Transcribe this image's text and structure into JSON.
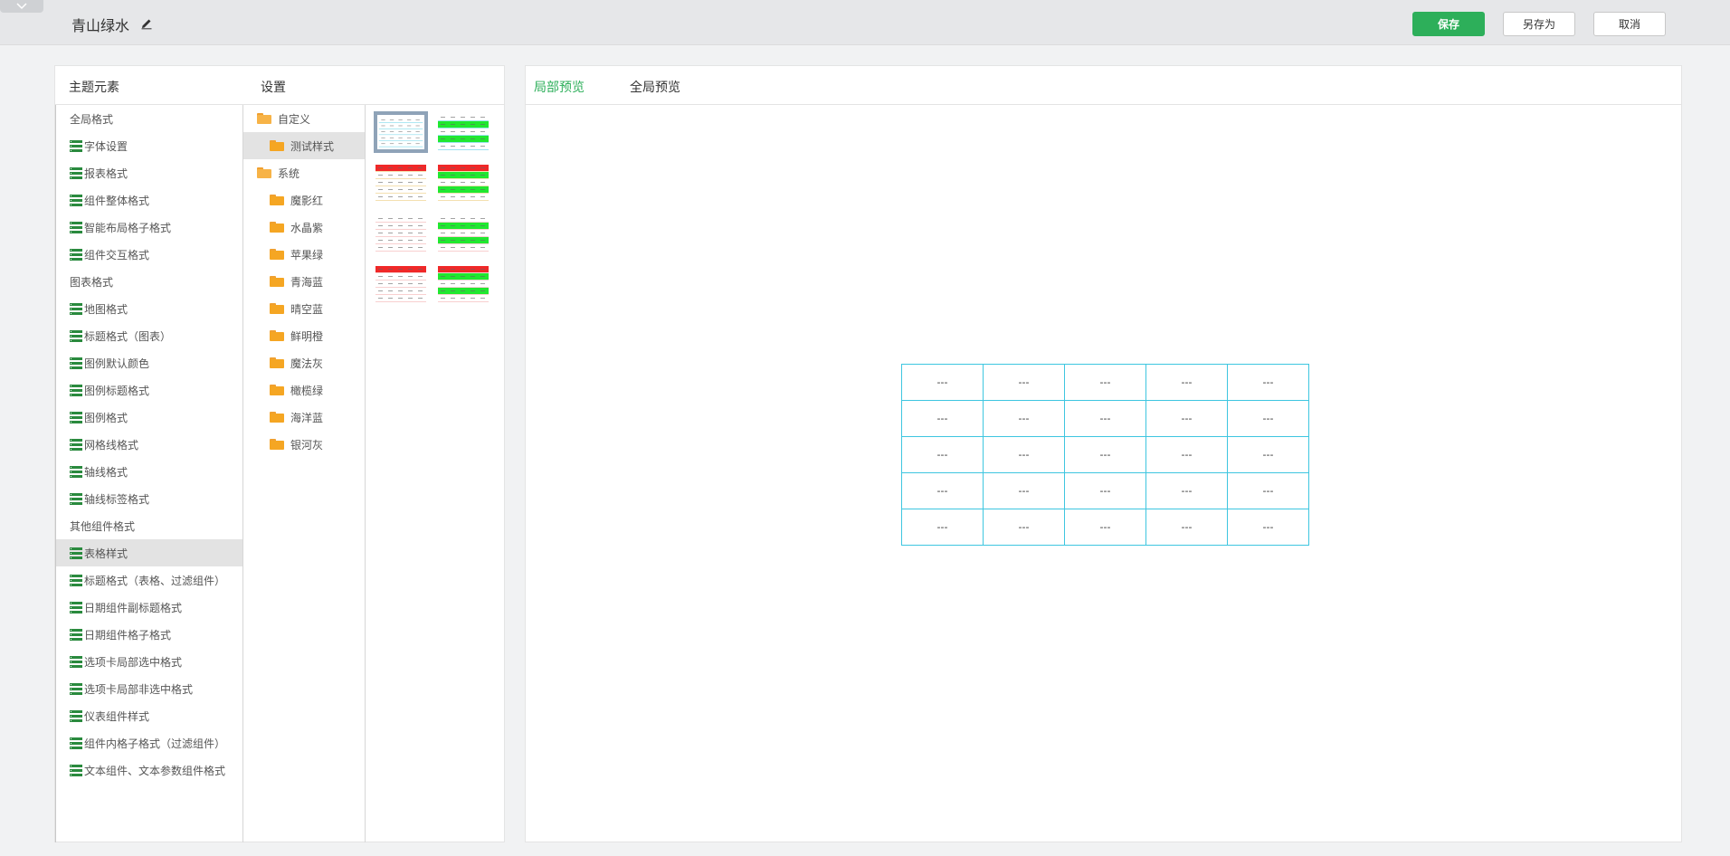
{
  "header": {
    "title": "青山绿水",
    "save_label": "保存",
    "save_as_label": "另存为",
    "cancel_label": "取消"
  },
  "left_panel": {
    "elements_heading": "主题元素",
    "settings_heading": "设置",
    "elements": [
      {
        "label": "全局格式",
        "group": true
      },
      {
        "label": "字体设置",
        "group": false
      },
      {
        "label": "报表格式",
        "group": false
      },
      {
        "label": "组件整体格式",
        "group": false
      },
      {
        "label": "智能布局格子格式",
        "group": false
      },
      {
        "label": "组件交互格式",
        "group": false
      },
      {
        "label": "图表格式",
        "group": true
      },
      {
        "label": "地图格式",
        "group": false
      },
      {
        "label": "标题格式（图表）",
        "group": false
      },
      {
        "label": "图例默认颜色",
        "group": false
      },
      {
        "label": "图例标题格式",
        "group": false
      },
      {
        "label": "图例格式",
        "group": false
      },
      {
        "label": "网格线格式",
        "group": false
      },
      {
        "label": "轴线格式",
        "group": false
      },
      {
        "label": "轴线标签格式",
        "group": false
      },
      {
        "label": "其他组件格式",
        "group": true
      },
      {
        "label": "表格样式",
        "group": false,
        "selected": true
      },
      {
        "label": "标题格式（表格、过滤组件）",
        "group": false
      },
      {
        "label": "日期组件副标题格式",
        "group": false
      },
      {
        "label": "日期组件格子格式",
        "group": false
      },
      {
        "label": "选项卡局部选中格式",
        "group": false
      },
      {
        "label": "选项卡局部非选中格式",
        "group": false
      },
      {
        "label": "仪表组件样式",
        "group": false
      },
      {
        "label": "组件内格子格式（过滤组件）",
        "group": false
      },
      {
        "label": "文本组件、文本参数组件格式",
        "group": false
      }
    ],
    "tree": [
      {
        "label": "自定义",
        "level": 0,
        "open": true
      },
      {
        "label": "测试样式",
        "level": 1,
        "selected": true
      },
      {
        "label": "系统",
        "level": 0,
        "open": true
      },
      {
        "label": "魔影红",
        "level": 1
      },
      {
        "label": "水晶紫",
        "level": 1
      },
      {
        "label": "苹果绿",
        "level": 1
      },
      {
        "label": "青海蓝",
        "level": 1
      },
      {
        "label": "晴空蓝",
        "level": 1
      },
      {
        "label": "鲜明橙",
        "level": 1
      },
      {
        "label": "魔法灰",
        "level": 1
      },
      {
        "label": "橄榄绿",
        "level": 1
      },
      {
        "label": "海洋蓝",
        "level": 1
      },
      {
        "label": "银河灰",
        "level": 1
      }
    ],
    "thumbnails": [
      {
        "header": "#ffffff",
        "row": "#ffffff",
        "alt_row": "#ffffff",
        "line": "#3ec6e0",
        "selected": true
      },
      {
        "header": "#ffffff",
        "row": "#20e830",
        "alt_row": "#ffffff",
        "line": "#3ec6e0"
      },
      {
        "header": "#f02828",
        "row": "#ffffff",
        "alt_row": "#ffffff",
        "line": "#e8c060"
      },
      {
        "header": "#f02828",
        "row": "#20e830",
        "alt_row": "#ffffff",
        "line": "#e8c060"
      },
      {
        "header": "#ffffff",
        "row": "#ffffff",
        "alt_row": "#ffffff",
        "line": "#f0a0a0"
      },
      {
        "header": "#ffffff",
        "row": "#20e830",
        "alt_row": "#ffffff",
        "line": "#f0a0a0"
      },
      {
        "header": "#f02828",
        "row": "#ffffff",
        "alt_row": "#ffffff",
        "line": "#f0a0a0"
      },
      {
        "header": "#f02828",
        "row": "#20e830",
        "alt_row": "#ffffff",
        "line": "#f0a0a0"
      }
    ]
  },
  "right_panel": {
    "tab_local": "局部预览",
    "tab_global": "全局预览",
    "preview_table": [
      [
        "---",
        "---",
        "---",
        "---",
        "---"
      ],
      [
        "---",
        "---",
        "---",
        "---",
        "---"
      ],
      [
        "---",
        "---",
        "---",
        "---",
        "---"
      ],
      [
        "---",
        "---",
        "---",
        "---",
        "---"
      ],
      [
        "---",
        "---",
        "---",
        "---",
        "---"
      ]
    ]
  },
  "colors": {
    "accent": "#2daf5a",
    "table_border": "#3ec6e0",
    "folder": "#f5a623",
    "element_icon": "#2a8a3e"
  },
  "icons": {
    "collapse": "chevron-down-icon",
    "edit_title": "pencil-icon",
    "element": "list-icon",
    "folder": "folder-icon"
  }
}
